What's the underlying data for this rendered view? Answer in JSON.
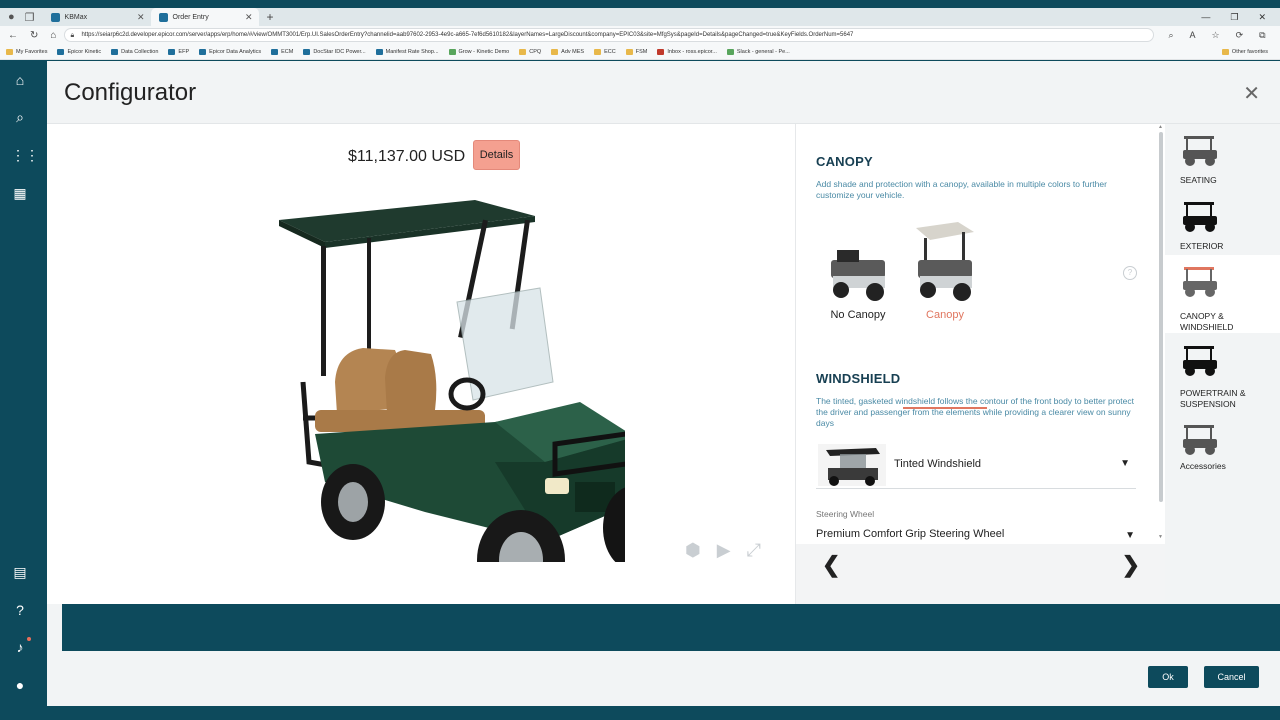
{
  "browser": {
    "tabs": [
      {
        "label": "KBMax",
        "active": false
      },
      {
        "label": "Order Entry",
        "active": true
      }
    ],
    "url": "https://seiarp6c2d.developer.epicor.com/server/apps/erp/home/#/view/OMMT3001/Erp.UI.SalesOrderEntry?channelid=aab97602-2953-4e9c-a665-7ef6d5610182&layerNames=LargeDiscount&company=EPIC03&site=MfgSys&pageId=Details&pageChanged=true&KeyFields.OrderNum=5647",
    "bookmarks": [
      "My Favorites",
      "Epicor Kinetic",
      "Data Collection",
      "EFP",
      "Epicor Data Analytics",
      "ECM",
      "DocStar IDC Power...",
      "Manifest Rate Shop...",
      "Grow - Kinetic Demo",
      "CPQ",
      "Adv MES",
      "ECC",
      "FSM",
      "Inbox - ross.epicor...",
      "Slack - general - Pe..."
    ],
    "other_favorites": "Other favorites"
  },
  "modal": {
    "title": "Configurator",
    "price": "$11,137.00 USD",
    "details_label": "Details",
    "ok_label": "Ok",
    "cancel_label": "Cancel"
  },
  "canopy": {
    "title": "CANOPY",
    "description": "Add shade and protection with a canopy, available in multiple colors to further customize your vehicle.",
    "options": [
      {
        "label": "No Canopy",
        "selected": false
      },
      {
        "label": "Canopy",
        "selected": true
      }
    ],
    "help": "?"
  },
  "windshield": {
    "title": "WINDSHIELD",
    "description": "The tinted, gasketed windshield follows the contour of the front body to better protect the driver and passenger from the elements while providing a clearer view on sunny days",
    "value": "Tinted Windshield"
  },
  "steering": {
    "label": "Steering Wheel",
    "value": "Premium Comfort Grip Steering Wheel"
  },
  "steps": [
    {
      "label": "SEATING",
      "active": false
    },
    {
      "label": "EXTERIOR",
      "active": false
    },
    {
      "label": "CANOPY & WINDSHIELD",
      "active": true
    },
    {
      "label": "POWERTRAIN & SUSPENSION",
      "active": false
    },
    {
      "label": "Accessories",
      "active": false
    }
  ],
  "colors": {
    "accent": "#e0765f",
    "brand": "#0d4a5c"
  }
}
